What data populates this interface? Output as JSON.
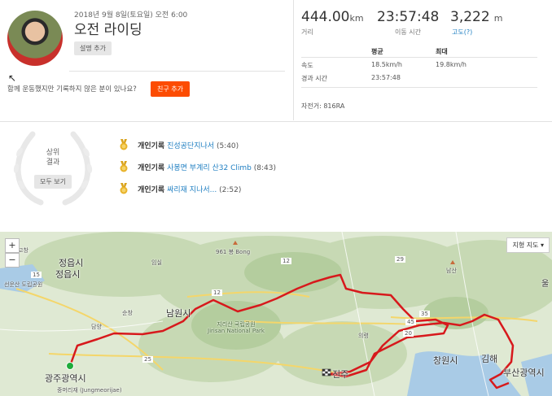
{
  "header": {
    "date": "2018년 9월 8일(토요일) 오전 6:00",
    "title": "오전 라이딩",
    "description_button": "설명 추가",
    "friend_question": "함께 운동했지만 기록하지 않은 분이 있나요?",
    "friend_button": "친구 추가"
  },
  "stats": {
    "distance": {
      "value": "444.00",
      "unit": "km",
      "label": "거리"
    },
    "moving_time": {
      "value": "23:57:48",
      "label": "이동 시간"
    },
    "elevation": {
      "value": "3,222",
      "unit": "m",
      "label": "고도(?)"
    },
    "table": {
      "col_avg": "평균",
      "col_max": "최대",
      "speed_label": "속도",
      "speed_avg": "18.5km/h",
      "speed_max": "19.8km/h",
      "elapsed_label": "경과 시간",
      "elapsed_avg": "23:57:48"
    },
    "bike": "자전거: 816RA"
  },
  "achievements": {
    "title_line1": "상위",
    "title_line2": "결과",
    "show_all": "모두 보기",
    "items": [
      {
        "prefix": "개인기록",
        "name": "진성공단지나서",
        "time": "(5:40)"
      },
      {
        "prefix": "개인기록",
        "name": "사봉면 부계리 산32 Climb",
        "time": "(8:43)"
      },
      {
        "prefix": "개인기록",
        "name": "싸리재 지나서...",
        "time": "(2:52)"
      }
    ]
  },
  "map": {
    "zoom_in": "+",
    "zoom_out": "−",
    "map_type": "지형 지도 ▾",
    "route_color": "#d7191c",
    "places": {
      "jeongeup1": "정읍시",
      "jeongeup2": "정읍시",
      "namwon": "남원시",
      "gwangju": "광주광역시",
      "changwon": "창원시",
      "gimhae": "김해",
      "busan": "부산광역시",
      "jinju": "진주",
      "bong": "961 봉 Bong",
      "jirisan": "지리산 국립공원 Jirisan National Park",
      "imsil": "임실",
      "uiryeong": "의령",
      "namsan": "남산",
      "ul": "울",
      "gochang": "고창",
      "damyang": "담양",
      "sunchang": "순창",
      "jungmeori": "중머리재 (Jungmeorijae)",
      "seonun": "선운산 도립공원"
    },
    "roads": [
      "15",
      "12",
      "12",
      "25",
      "45",
      "20",
      "29",
      "35"
    ]
  }
}
